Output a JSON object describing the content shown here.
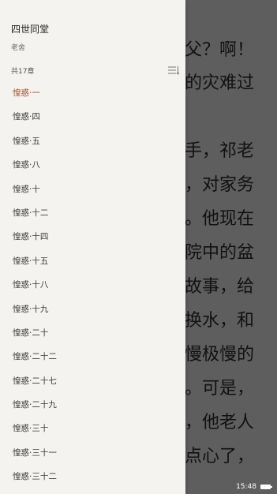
{
  "book": {
    "title": "四世同堂",
    "author": "老舍"
  },
  "toc": {
    "count_label": "共17章",
    "sort_icon": "sort-lines-icon",
    "current_color": "#a0522d",
    "chapters": [
      "惶惑·一",
      "惶惑·四",
      "惶惑·五",
      "惶惑·八",
      "惶惑·十",
      "惶惑·十二",
      "惶惑·十四",
      "惶惑·十五",
      "惶惑·十八",
      "惶惑·十九",
      "惶惑·二十",
      "惶惑·二十二",
      "惶惑·二十七",
      "惶惑·二十九",
      "惶惑·三十",
      "惶惑·三十一",
      "惶惑·三十二"
    ]
  },
  "reader": {
    "lines": [
      "父？啊！",
      "的灾难过",
      "手，祁老",
      "，对家务",
      "。他现在",
      "院中的盆",
      "故事，给",
      "换水，和",
      "慢极慢的",
      "。可是，",
      "，他老人",
      "点心了，"
    ]
  },
  "status": {
    "time": "15:48"
  }
}
